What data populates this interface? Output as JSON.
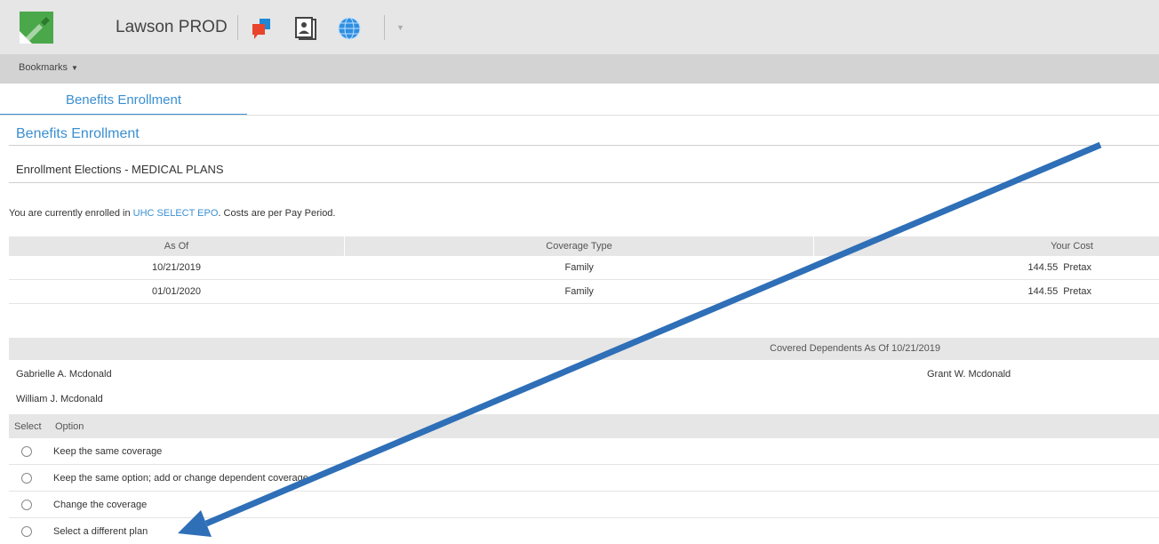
{
  "header": {
    "app_title": "Lawson PROD"
  },
  "bookmarks": {
    "label": "Bookmarks"
  },
  "tab": {
    "label": "Benefits Enrollment"
  },
  "page": {
    "title": "Benefits Enrollment",
    "section_title": "Enrollment Elections - MEDICAL PLANS",
    "enroll_prefix": "You are currently enrolled in",
    "plan_name": "UHC SELECT EPO",
    "enroll_suffix": ". Costs are per Pay Period."
  },
  "coverage_table": {
    "headers": [
      "As Of",
      "Coverage Type",
      "Your Cost"
    ],
    "rows": [
      {
        "as_of": "10/21/2019",
        "type": "Family",
        "cost": "144.55",
        "tax": "Pretax"
      },
      {
        "as_of": "01/01/2020",
        "type": "Family",
        "cost": "144.55",
        "tax": "Pretax"
      }
    ]
  },
  "dependents": {
    "header": "Covered Dependents As Of 10/21/2019",
    "names": [
      "Gabrielle A. Mcdonald",
      "Grant W. Mcdonald",
      "William J. Mcdonald"
    ]
  },
  "options": {
    "headers": {
      "select": "Select",
      "option": "Option"
    },
    "items": [
      "Keep the same coverage",
      "Keep the same option; add or change dependent coverage",
      "Change the coverage",
      "Select a different plan"
    ]
  },
  "colors": {
    "accent": "#3a8fd1",
    "arrow": "#2e6fb7",
    "header_bg": "#e6e6e6"
  }
}
